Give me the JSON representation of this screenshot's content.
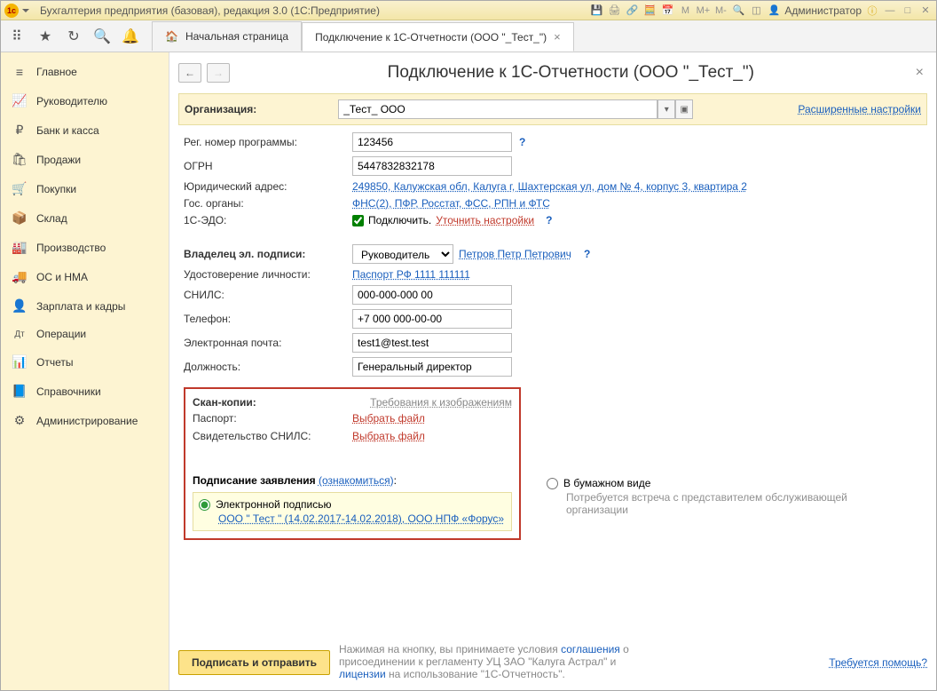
{
  "titlebar": {
    "app_title": "Бухгалтерия предприятия (базовая), редакция 3.0  (1С:Предприятие)",
    "user_label": "Администратор"
  },
  "tabs": {
    "home": "Начальная страница",
    "active": "Подключение к 1С-Отчетности (ООО \"_Тест_\")"
  },
  "sidebar": [
    {
      "icon": "≡",
      "label": "Главное"
    },
    {
      "icon": "📈",
      "label": "Руководителю"
    },
    {
      "icon": "₽",
      "label": "Банк и касса"
    },
    {
      "icon": "🛍",
      "label": "Продажи"
    },
    {
      "icon": "🛒",
      "label": "Покупки"
    },
    {
      "icon": "📦",
      "label": "Склад"
    },
    {
      "icon": "🏭",
      "label": "Производство"
    },
    {
      "icon": "🚚",
      "label": "ОС и НМА"
    },
    {
      "icon": "👤",
      "label": "Зарплата и кадры"
    },
    {
      "icon": "Дт",
      "label": "Операции"
    },
    {
      "icon": "📊",
      "label": "Отчеты"
    },
    {
      "icon": "📘",
      "label": "Справочники"
    },
    {
      "icon": "⚙",
      "label": "Администрирование"
    }
  ],
  "page": {
    "title": "Подключение к 1С-Отчетности (ООО \"_Тест_\")",
    "org_label": "Организация:",
    "org_value": "_Тест_ ООО",
    "adv_settings": "Расширенные настройки",
    "reg_num_label": "Рег. номер программы:",
    "reg_num": "123456",
    "ogrn_label": "ОГРН",
    "ogrn": "5447832832178",
    "addr_label": "Юридический адрес:",
    "addr": "249850, Калужская обл, Калуга г, Шахтерская ул, дом № 4, корпус 3, квартира 2",
    "gos_label": "Гос. органы:",
    "gos": "ФНС(2), ПФР, Росстат, ФСС, РПН и ФТС",
    "edo_label": "1С-ЭДО:",
    "edo_connect": "Подключить.",
    "edo_refine": "Уточнить настройки",
    "owner_label": "Владелец эл. подписи:",
    "owner_role": "Руководитель",
    "owner_name": "Петров Петр Петрович",
    "id_label": "Удостоверение личности:",
    "id_value": "Паспорт РФ 1111 111111",
    "snils_label": "СНИЛС:",
    "snils": "000-000-000 00",
    "phone_label": "Телефон:",
    "phone": "+7 000 000-00-00",
    "email_label": "Электронная почта:",
    "email": "test1@test.test",
    "position_label": "Должность:",
    "position": "Генеральный директор",
    "scan_label": "Скан-копии:",
    "scan_req": "Требования к изображениям",
    "passport_label": "Паспорт:",
    "choose_file": "Выбрать файл",
    "snils_doc_label": "Свидетельство СНИЛС:",
    "sign_title": "Подписание заявления",
    "sign_learn": "(ознакомиться)",
    "opt1_label": "Электронной подписью",
    "opt1_detail": "ООО \" Тест \" (14.02.2017-14.02.2018), ООО НПФ «Форус»",
    "opt2_label": "В бумажном виде",
    "opt2_detail": "Потребуется встреча с представителем обслуживающей организации",
    "submit": "Подписать и отправить",
    "disclaimer1": "Нажимая на кнопку, вы принимаете условия ",
    "disclaimer_link1": "соглашения",
    "disclaimer2": " о присоединении к регламенту УЦ ЗАО \"Калуга Астрал\" и ",
    "disclaimer_link2": "лицензии",
    "disclaimer3": " на использование \"1С-Отчетность\".",
    "help": "Требуется помощь?"
  }
}
